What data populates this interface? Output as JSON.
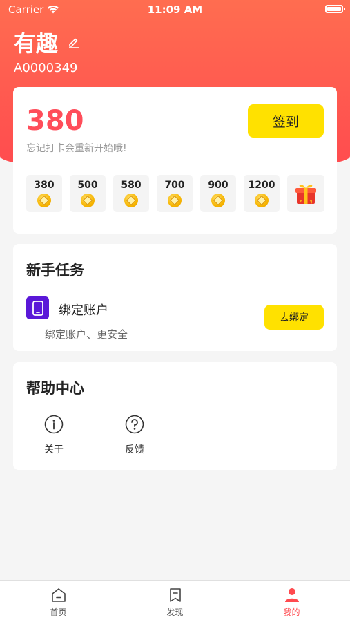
{
  "status_bar": {
    "carrier": "Carrier",
    "time": "11:09 AM"
  },
  "profile": {
    "name": "有趣",
    "user_id": "A0000349",
    "edit_icon": "edit-pencil-icon"
  },
  "checkin": {
    "points": "380",
    "hint": "忘记打卡会重新开始哦!",
    "button_label": "签到",
    "days": [
      {
        "value": "380"
      },
      {
        "value": "500"
      },
      {
        "value": "580"
      },
      {
        "value": "700"
      },
      {
        "value": "900"
      },
      {
        "value": "1200"
      }
    ],
    "final_reward_icon": "gift-icon"
  },
  "novice_tasks": {
    "title": "新手任务",
    "task": {
      "icon": "phone-icon",
      "name": "绑定账户",
      "description": "绑定账户、更安全",
      "button_label": "去绑定"
    }
  },
  "help_center": {
    "title": "帮助中心",
    "items": [
      {
        "icon": "info-icon",
        "label": "关于"
      },
      {
        "icon": "question-icon",
        "label": "反馈"
      }
    ]
  },
  "tab_bar": {
    "tabs": [
      {
        "label": "首页",
        "icon": "home-icon",
        "active": false
      },
      {
        "label": "发现",
        "icon": "bookmark-icon",
        "active": false
      },
      {
        "label": "我的",
        "icon": "user-icon",
        "active": true
      }
    ]
  },
  "colors": {
    "header_gradient_top": "#ff6d50",
    "header_gradient_bottom": "#ff4a4f",
    "accent_yellow": "#ffe100",
    "points_red": "#ff4d5a",
    "task_icon_purple": "#5a18d8"
  }
}
